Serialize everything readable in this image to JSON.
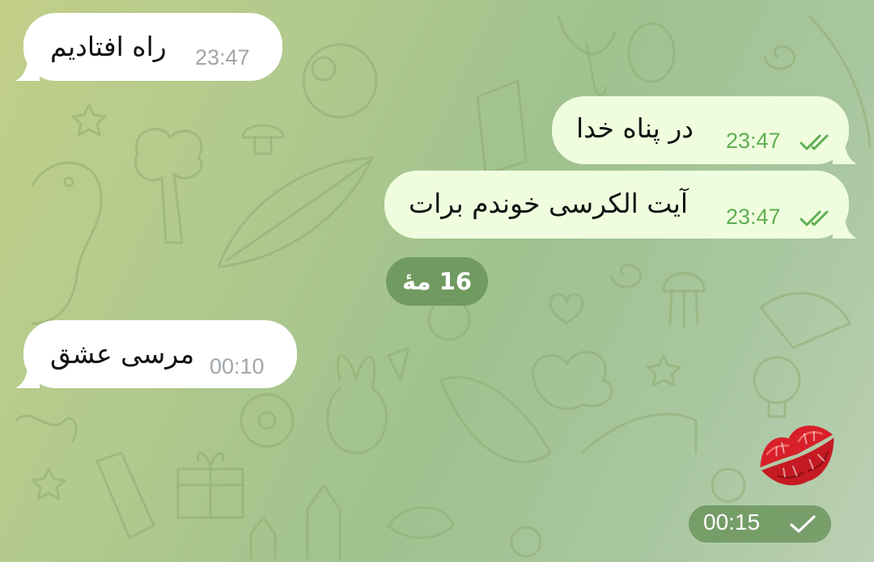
{
  "messages": [
    {
      "direction": "incoming",
      "text": "راه افتادیم",
      "time": "23:47"
    },
    {
      "direction": "outgoing",
      "text": "در پناه خدا",
      "time": "23:47",
      "status": "read"
    },
    {
      "direction": "outgoing",
      "text": "آیت الکرسی خوندم برات",
      "time": "23:47",
      "status": "read"
    },
    {
      "direction": "incoming",
      "text": "مرسی عشق",
      "time": "00:10"
    },
    {
      "direction": "outgoing",
      "type": "sticker",
      "sticker": "kiss-lips-sticker",
      "time": "00:15",
      "status": "sent"
    }
  ],
  "date_separator": "16 مهٔ",
  "colors": {
    "incoming_bubble": "#ffffff",
    "outgoing_bubble": "#effdde",
    "outgoing_time": "#5fae52",
    "incoming_time": "#a0a6ab",
    "date_pill": "#608c50",
    "sticker_red": "#d8202a"
  },
  "icons": {
    "read_status": "double-check-icon",
    "sent_status": "single-check-icon"
  }
}
